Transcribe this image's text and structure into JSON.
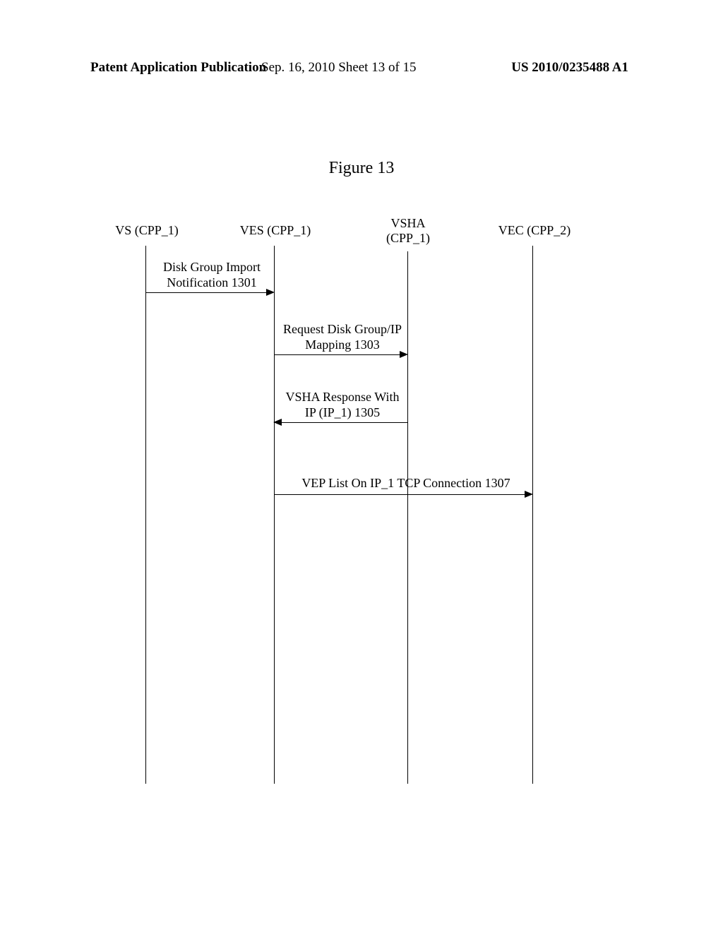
{
  "header": {
    "left": "Patent Application Publication",
    "mid": "Sep. 16, 2010  Sheet 13 of 15",
    "right": "US 2010/0235488 A1"
  },
  "figure_title": "Figure 13",
  "lifelines": {
    "vs": "VS (CPP_1)",
    "ves": "VES (CPP_1)",
    "vsha_line1": "VSHA",
    "vsha_line2": "(CPP_1)",
    "vec": "VEC (CPP_2)"
  },
  "messages": {
    "m1_line1": "Disk Group Import",
    "m1_line2": "Notification 1301",
    "m2_line1": "Request Disk Group/IP",
    "m2_line2": "Mapping 1303",
    "m3_line1": "VSHA Response With",
    "m3_line2": "IP (IP_1) 1305",
    "m4": "VEP List On IP_1 TCP Connection 1307"
  },
  "chart_data": {
    "type": "sequence-diagram",
    "participants": [
      "VS (CPP_1)",
      "VES (CPP_1)",
      "VSHA (CPP_1)",
      "VEC (CPP_2)"
    ],
    "messages": [
      {
        "from": "VS (CPP_1)",
        "to": "VES (CPP_1)",
        "label": "Disk Group Import Notification 1301",
        "direction": "right"
      },
      {
        "from": "VES (CPP_1)",
        "to": "VSHA (CPP_1)",
        "label": "Request Disk Group/IP Mapping 1303",
        "direction": "right"
      },
      {
        "from": "VSHA (CPP_1)",
        "to": "VES (CPP_1)",
        "label": "VSHA Response With IP (IP_1) 1305",
        "direction": "left"
      },
      {
        "from": "VES (CPP_1)",
        "to": "VEC (CPP_2)",
        "label": "VEP List On IP_1 TCP Connection 1307",
        "direction": "right"
      }
    ]
  }
}
